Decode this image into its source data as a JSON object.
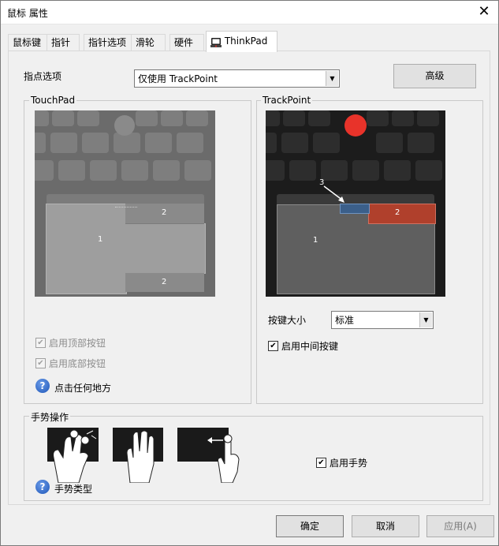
{
  "window": {
    "title": "鼠标 属性",
    "close_glyph": "✕"
  },
  "tabs": [
    {
      "label": "鼠标键"
    },
    {
      "label": "指针"
    },
    {
      "label": "指针选项"
    },
    {
      "label": "滑轮"
    },
    {
      "label": "硬件"
    },
    {
      "label": "ThinkPad",
      "active": true
    }
  ],
  "pointing": {
    "label": "指点选项",
    "selected": "仅使用 TrackPoint",
    "advanced_button": "高级"
  },
  "touchpad": {
    "group_label": "TouchPad",
    "area_labels": {
      "left": "1",
      "top_right": "2",
      "bottom_right": "2"
    },
    "top_buttons_checkbox": {
      "label": "启用顶部按钮",
      "checked": true,
      "disabled": true
    },
    "bottom_buttons_checkbox": {
      "label": "启用底部按钮",
      "checked": true,
      "disabled": true
    },
    "tap_anywhere_link": "点击任何地方"
  },
  "trackpoint": {
    "group_label": "TrackPoint",
    "area_labels": {
      "left": "1",
      "right": "2",
      "middle": "3"
    },
    "button_size_label": "按键大小",
    "button_size_value": "标准",
    "middle_button_checkbox": {
      "label": "启用中间按键",
      "checked": true
    }
  },
  "gestures": {
    "group_label": "手势操作",
    "enable_checkbox": {
      "label": "启用手势",
      "checked": true
    },
    "types_link": "手势类型"
  },
  "footer": {
    "ok": "确定",
    "cancel": "取消",
    "apply": "应用(A)"
  },
  "colors": {
    "trackpoint_red": "#e8332a",
    "right_click_zone": "#b0402c",
    "middle_zone": "#3b5f8a"
  },
  "icons": [
    "close-icon",
    "thinkpad-tab-icon",
    "dropdown-arrow-icon",
    "help-icon",
    "checkmark-icon"
  ]
}
